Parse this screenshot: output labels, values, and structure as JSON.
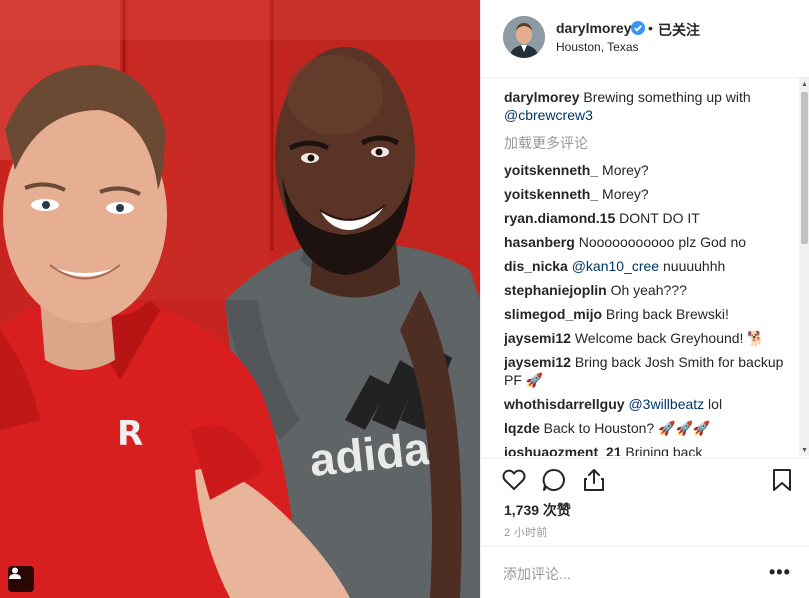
{
  "post": {
    "username": "darylmorey",
    "dot": "•",
    "follow_status": "已关注",
    "location": "Houston, Texas",
    "likes": "1,739 次赞",
    "time": "2 小时前",
    "add_comment_placeholder": "添加评论...",
    "more": "•••"
  },
  "caption": {
    "user": "darylmorey",
    "text": " Brewing something up with ",
    "mention": "@cbrewcrew3"
  },
  "load_more": "加载更多评论",
  "comments": [
    {
      "user": "yoitskenneth_",
      "text": " Morey?"
    },
    {
      "user": "yoitskenneth_",
      "text": " Morey?"
    },
    {
      "user": "ryan.diamond.15",
      "text": " DONT DO IT"
    },
    {
      "user": "hasanberg",
      "text": " Nooooooooooo plz God no"
    },
    {
      "user": "dis_nicka",
      "mention": "@kan10_cree",
      "text": " nuuuuhhh"
    },
    {
      "user": "stephaniejoplin",
      "text": " Oh yeah???"
    },
    {
      "user": "slimegod_mijo",
      "text": " Bring back Brewski!"
    },
    {
      "user": "jaysemi12",
      "text": " Welcome back Greyhound! 🐕"
    },
    {
      "user": "jaysemi12",
      "text": " Bring back Josh Smith for backup PF 🚀"
    },
    {
      "user": "whothisdarrellguy",
      "mention": "@3willbeatz",
      "text": " lol"
    },
    {
      "user": "lqzde",
      "text": " Back to Houston? 🚀🚀🚀"
    },
    {
      "user": "joshuaozment_21",
      "text": " Brining back"
    }
  ],
  "icons": {
    "verified": "verified-badge-icon",
    "like": "heart-icon",
    "comment": "comment-bubble-icon",
    "share": "share-icon",
    "save": "bookmark-icon",
    "tag": "user-tag-icon"
  },
  "colors": {
    "verified": "#3897f0",
    "mention": "#003569",
    "muted": "#999999",
    "wall_red": "#c8241f",
    "jersey_red": "#d81e1e",
    "shirt_grey": "#5f6466"
  }
}
